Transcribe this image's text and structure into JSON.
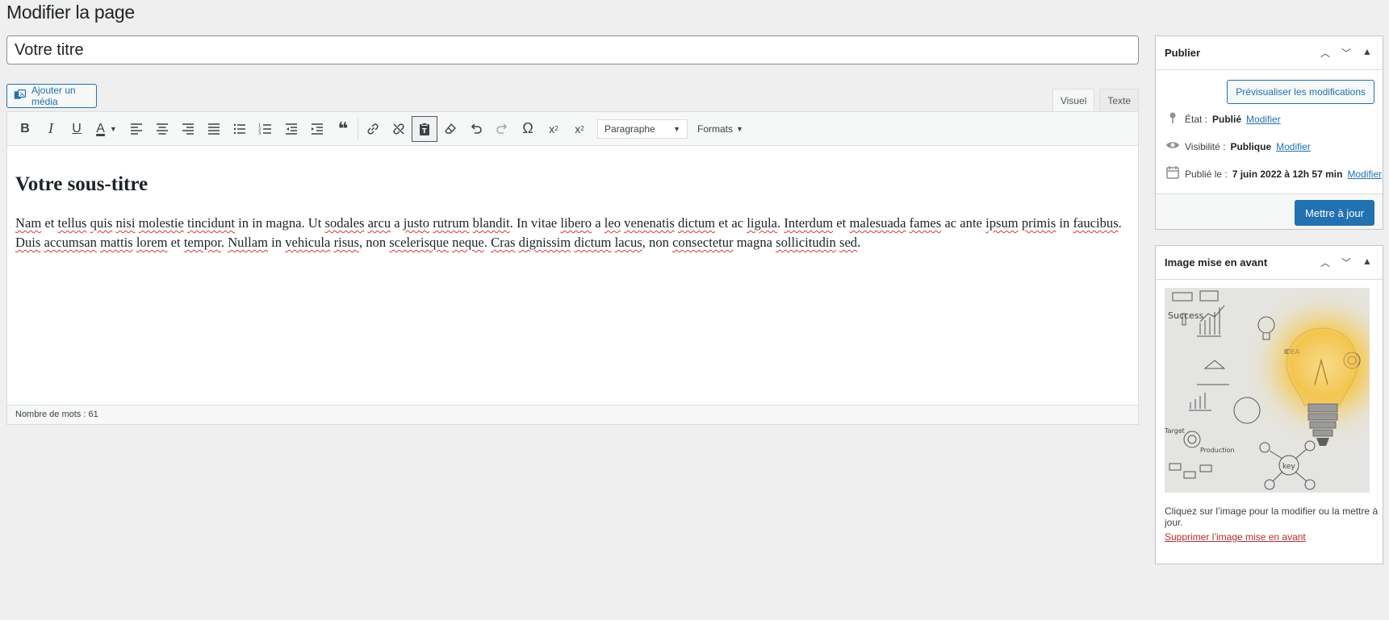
{
  "page": {
    "title": "Modifier la page"
  },
  "post": {
    "title_value": "Votre titre"
  },
  "editor": {
    "add_media_label": "Ajouter un média",
    "tabs": [
      {
        "label": "Visuel",
        "active": true
      },
      {
        "label": "Texte",
        "active": false
      }
    ],
    "toolbar": {
      "bold_label": "B",
      "italic_label": "I",
      "underline_label": "U",
      "text_color_label": "A",
      "block_format_value": "Paragraphe",
      "formats_label": "Formats"
    },
    "content": {
      "heading": "Votre sous-titre",
      "paragraph": [
        {
          "t": "Nam",
          "s": true
        },
        {
          "t": " et "
        },
        {
          "t": "tellus",
          "s": true
        },
        {
          "t": " "
        },
        {
          "t": "quis",
          "s": true
        },
        {
          "t": " "
        },
        {
          "t": "nisi",
          "s": true
        },
        {
          "t": " "
        },
        {
          "t": "molestie",
          "s": true
        },
        {
          "t": " "
        },
        {
          "t": "tincidunt",
          "s": true
        },
        {
          "t": " in in magna. Ut "
        },
        {
          "t": "sodales",
          "s": true
        },
        {
          "t": " "
        },
        {
          "t": "arcu",
          "s": true
        },
        {
          "t": " a "
        },
        {
          "t": "justo",
          "s": true
        },
        {
          "t": " "
        },
        {
          "t": "rutrum",
          "s": true
        },
        {
          "t": " "
        },
        {
          "t": "blandit",
          "s": true
        },
        {
          "t": ". In vitae "
        },
        {
          "t": "libero",
          "s": true
        },
        {
          "t": " a "
        },
        {
          "t": "leo",
          "s": true
        },
        {
          "t": " "
        },
        {
          "t": "venenatis",
          "s": true
        },
        {
          "t": " "
        },
        {
          "t": "dictum",
          "s": true
        },
        {
          "t": " et ac "
        },
        {
          "t": "ligula",
          "s": true
        },
        {
          "t": ". "
        },
        {
          "t": "Interdum",
          "s": true
        },
        {
          "t": " et "
        },
        {
          "t": "malesuada",
          "s": true
        },
        {
          "t": " "
        },
        {
          "t": "fames",
          "s": true
        },
        {
          "t": " ac ante "
        },
        {
          "t": "ipsum",
          "s": true
        },
        {
          "t": " "
        },
        {
          "t": "primis",
          "s": true
        },
        {
          "t": " in "
        },
        {
          "t": "faucibus",
          "s": true
        },
        {
          "t": ". "
        },
        {
          "t": "Duis",
          "s": true
        },
        {
          "t": " "
        },
        {
          "t": "accumsan",
          "s": true
        },
        {
          "t": " "
        },
        {
          "t": "mattis",
          "s": true
        },
        {
          "t": " "
        },
        {
          "t": "lorem",
          "s": true
        },
        {
          "t": " et "
        },
        {
          "t": "tempor",
          "s": true
        },
        {
          "t": ". "
        },
        {
          "t": "Nullam",
          "s": true
        },
        {
          "t": " in "
        },
        {
          "t": "vehicula",
          "s": true
        },
        {
          "t": " "
        },
        {
          "t": "risus",
          "s": true
        },
        {
          "t": ", non "
        },
        {
          "t": "scelerisque",
          "s": true
        },
        {
          "t": " "
        },
        {
          "t": "neque",
          "s": true
        },
        {
          "t": ". "
        },
        {
          "t": "Cras",
          "s": true
        },
        {
          "t": " "
        },
        {
          "t": "dignissim",
          "s": true
        },
        {
          "t": " "
        },
        {
          "t": "dictum",
          "s": true
        },
        {
          "t": " "
        },
        {
          "t": "lacus",
          "s": true
        },
        {
          "t": ", non "
        },
        {
          "t": "consectetur",
          "s": true
        },
        {
          "t": " magna "
        },
        {
          "t": "sollicitudin",
          "s": true
        },
        {
          "t": " "
        },
        {
          "t": "sed",
          "s": true
        },
        {
          "t": "."
        }
      ]
    },
    "word_count": "Nombre de mots : 61"
  },
  "publish_box": {
    "title": "Publier",
    "preview_label": "Prévisualiser les modifications",
    "status_label": "État :",
    "status_value": "Publié",
    "status_edit": "Modifier",
    "visibility_label": "Visibilité :",
    "visibility_value": "Publique",
    "visibility_edit": "Modifier",
    "date_label": "Publié le :",
    "date_value": "7 juin 2022 à 12h 57 min",
    "date_edit": "Modifier",
    "update_label": "Mettre à jour"
  },
  "featured_box": {
    "title": "Image mise en avant",
    "help": "Cliquez sur l’image pour la modifier ou la mettre à jour.",
    "remove": "Supprimer l’image mise en avant",
    "image_text": {
      "success": "Success",
      "idea": "IDEA",
      "target": "Target",
      "production": "Production",
      "key": "key"
    }
  },
  "colors": {
    "accent": "#2271b1",
    "danger": "#b32d2e",
    "background": "#efefef"
  },
  "icons": [
    "media-icon",
    "bold-icon",
    "italic-icon",
    "underline-icon",
    "text-color-icon",
    "align-left-icon",
    "align-center-icon",
    "align-right-icon",
    "justify-icon",
    "bullet-list-icon",
    "numbered-list-icon",
    "outdent-icon",
    "indent-icon",
    "quote-icon",
    "link-icon",
    "unlink-icon",
    "paste-text-icon",
    "clear-format-icon",
    "undo-icon",
    "redo-icon",
    "special-char-icon",
    "superscript-icon",
    "subscript-icon",
    "pin-icon",
    "eye-icon",
    "calendar-icon"
  ]
}
